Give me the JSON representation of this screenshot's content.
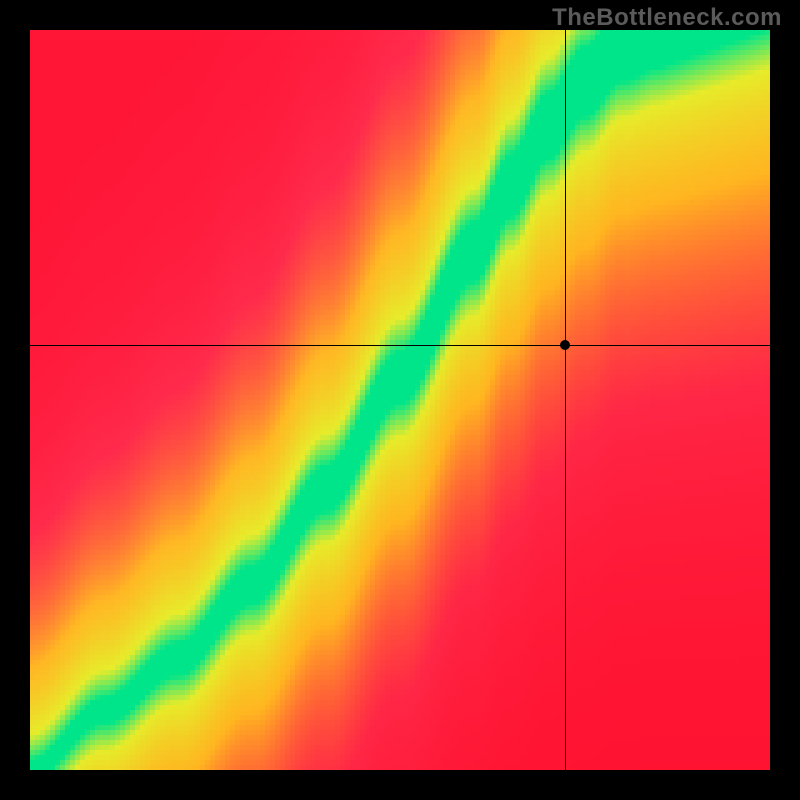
{
  "watermark": "TheBottleneck.com",
  "chart_data": {
    "type": "heatmap",
    "title": "",
    "xlabel": "",
    "ylabel": "",
    "xlim": [
      0,
      1
    ],
    "ylim": [
      0,
      1
    ],
    "grid": false,
    "legend": null,
    "crosshair": {
      "x": 0.723,
      "y": 0.575
    },
    "marker": {
      "x": 0.723,
      "y": 0.575
    },
    "color_scale": {
      "match": "#00e58a",
      "near": "#e6f02a",
      "mid": "#ffc020",
      "mismatch_hi": "#ff2a4a",
      "mismatch_lo": "#ff1030"
    },
    "optimal_curve": {
      "description": "y value at which score=1 (green ridge) for a given x; curve is roughly power-law, steeper near origin, then super-linear",
      "control_points_xy": [
        [
          0.0,
          0.0
        ],
        [
          0.1,
          0.08
        ],
        [
          0.2,
          0.15
        ],
        [
          0.3,
          0.25
        ],
        [
          0.4,
          0.38
        ],
        [
          0.5,
          0.53
        ],
        [
          0.6,
          0.7
        ],
        [
          0.65,
          0.79
        ],
        [
          0.7,
          0.87
        ],
        [
          0.75,
          0.93
        ],
        [
          0.8,
          0.98
        ],
        [
          0.85,
          1.0
        ]
      ]
    },
    "band_width": 0.05,
    "resolution": 148
  }
}
